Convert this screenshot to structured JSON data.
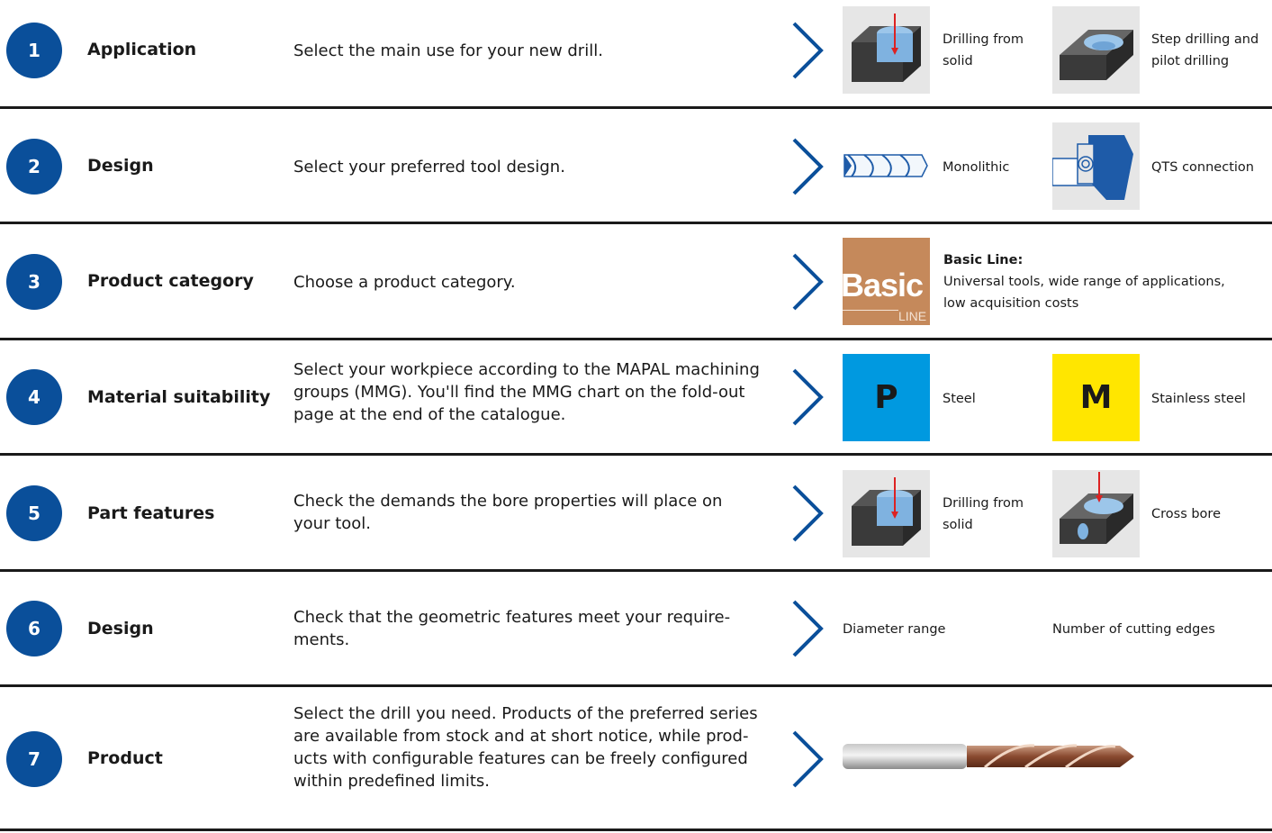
{
  "steps": [
    {
      "num": "1",
      "title": "Application",
      "desc": "Select the main use for your new drill.",
      "opt1": "Drilling from solid",
      "opt2": "Step drilling and pilot drilling"
    },
    {
      "num": "2",
      "title": "Design",
      "desc": "Select your preferred tool design.",
      "opt1": "Monolithic",
      "opt2": "QTS connection"
    },
    {
      "num": "3",
      "title": "Product category",
      "desc": "Choose a product category.",
      "basic_word": "Basic",
      "basic_line": "LINE",
      "cat_title": "Basic Line:",
      "cat_text": "Universal tools, wide range of applications, low acquisition costs"
    },
    {
      "num": "4",
      "title": "Material suitability",
      "desc": "Select your workpiece according to the MAPAL machining groups (MMG). You'll find the MMG chart on the fold-out page at the end of the catalogue.",
      "mat1_letter": "P",
      "opt1": "Steel",
      "mat2_letter": "M",
      "opt2": "Stainless steel"
    },
    {
      "num": "5",
      "title": "Part features",
      "desc": "Check the demands the bore properties will place on your tool.",
      "opt1": "Drilling from solid",
      "opt2": "Cross bore"
    },
    {
      "num": "6",
      "title": "Design",
      "desc": "Check that the geometric features meet your require-ments.",
      "opt1": "Diameter range",
      "opt2": "Number of cutting edges"
    },
    {
      "num": "7",
      "title": "Product",
      "desc": "Select the drill you need. Products of the preferred series are available from stock and at short notice, while prod-ucts with configurable features can be freely configured within predefined limits."
    }
  ],
  "colors": {
    "accent": "#0a4f9a",
    "mmg_p": "#0099e0",
    "mmg_m": "#ffe600",
    "basic": "#c5895b"
  }
}
